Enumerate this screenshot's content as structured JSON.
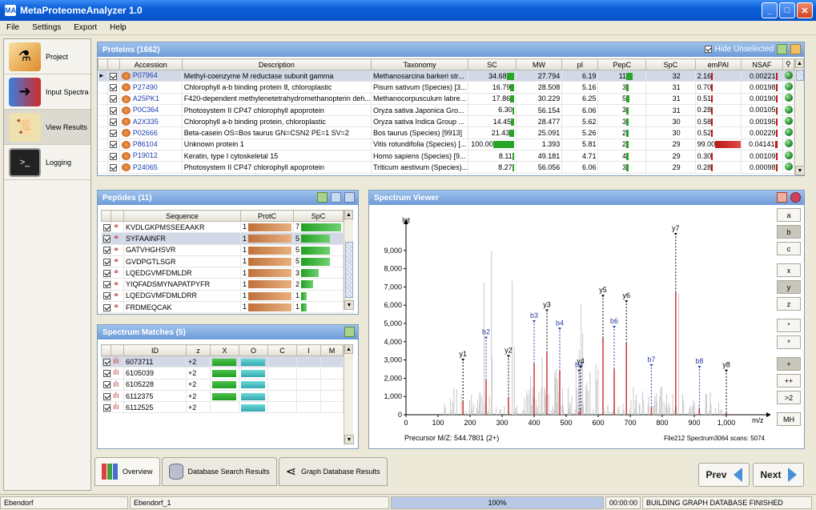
{
  "window": {
    "title": "MetaProteomeAnalyzer 1.0",
    "app_icon": "MA"
  },
  "menu": [
    "File",
    "Settings",
    "Export",
    "Help"
  ],
  "nav": [
    {
      "label": "Project",
      "icon": "flask-icon"
    },
    {
      "label": "Input Spectra",
      "icon": "spectra-arrow-icon"
    },
    {
      "label": "View Results",
      "icon": "scroll-icon"
    },
    {
      "label": "Logging",
      "icon": "terminal-icon"
    }
  ],
  "proteins": {
    "title": "Proteins (1662)",
    "hide_unselected": "Hide Unselected",
    "columns": [
      "Accession",
      "Description",
      "Taxonomy",
      "SC",
      "MW",
      "pI",
      "PepC",
      "SpC",
      "emPAI",
      "NSAF"
    ],
    "rows": [
      {
        "acc": "P07964",
        "desc": "Methyl-coenzyme M reductase subunit gamma",
        "tax": "Methanosarcina barkeri str...",
        "sc": "34.68",
        "sc_frac": 0.35,
        "mw": "27.794",
        "pi": "6.19",
        "pepc": "11",
        "pepc_frac": 1.0,
        "spc": "32",
        "empai": "2.16",
        "empai_frac": 0.02,
        "nsaf": "0.00221",
        "nsaf_frac": 0.05
      },
      {
        "acc": "P27490",
        "desc": "Chlorophyll a-b binding protein 8, chloroplastic",
        "tax": "Pisum sativum (Species) [3...",
        "sc": "16.79",
        "sc_frac": 0.17,
        "mw": "28.508",
        "pi": "5.16",
        "pepc": "3",
        "pepc_frac": 0.27,
        "spc": "31",
        "empai": "0.70",
        "empai_frac": 0.01,
        "nsaf": "0.00198",
        "nsaf_frac": 0.05
      },
      {
        "acc": "A25PK1",
        "desc": "F420-dependent methylenetetrahydromethanopterin deh...",
        "tax": "Methanocorpusculum labre...",
        "sc": "17.86",
        "sc_frac": 0.18,
        "mw": "30.229",
        "pi": "6.25",
        "pepc": "5",
        "pepc_frac": 0.45,
        "spc": "31",
        "empai": "0.51",
        "empai_frac": 0.01,
        "nsaf": "0.00190",
        "nsaf_frac": 0.05
      },
      {
        "acc": "P0C364",
        "desc": "Photosystem II CP47 chlorophyll apoprotein",
        "tax": "Oryza sativa Japonica Gro...",
        "sc": "6.30",
        "sc_frac": 0.06,
        "mw": "56.154",
        "pi": "6.06",
        "pepc": "3",
        "pepc_frac": 0.27,
        "spc": "31",
        "empai": "0.28",
        "empai_frac": 0.0,
        "nsaf": "0.00105",
        "nsaf_frac": 0.03
      },
      {
        "acc": "A2X335",
        "desc": "Chlorophyll a-b binding protein, chloroplastic",
        "tax": "Oryza sativa Indica Group ...",
        "sc": "14.45",
        "sc_frac": 0.14,
        "mw": "28.477",
        "pi": "5.62",
        "pepc": "3",
        "pepc_frac": 0.27,
        "spc": "30",
        "empai": "0.58",
        "empai_frac": 0.01,
        "nsaf": "0.00195",
        "nsaf_frac": 0.05
      },
      {
        "acc": "P02666",
        "desc": "Beta-casein OS=Bos taurus GN=CSN2 PE=1 SV=2",
        "tax": "Bos taurus (Species) [9913]",
        "sc": "21.43",
        "sc_frac": 0.21,
        "mw": "25.091",
        "pi": "5.26",
        "pepc": "2",
        "pepc_frac": 0.18,
        "spc": "30",
        "empai": "0.52",
        "empai_frac": 0.01,
        "nsaf": "0.00229",
        "nsaf_frac": 0.06
      },
      {
        "acc": "P86104",
        "desc": "Unknown protein 1",
        "tax": "Vitis rotundifolia (Species) [...",
        "sc": "100.00",
        "sc_frac": 1.0,
        "mw": "1.393",
        "pi": "5.81",
        "pepc": "2",
        "pepc_frac": 0.18,
        "spc": "29",
        "empai": "99.00",
        "empai_frac": 1.0,
        "nsaf": "0.04141",
        "nsaf_frac": 1.0
      },
      {
        "acc": "P19012",
        "desc": "Keratin, type I cytoskeletal 15",
        "tax": "Homo sapiens (Species) [9...",
        "sc": "8.11",
        "sc_frac": 0.08,
        "mw": "49.181",
        "pi": "4.71",
        "pepc": "4",
        "pepc_frac": 0.36,
        "spc": "29",
        "empai": "0.30",
        "empai_frac": 0.0,
        "nsaf": "0.00109",
        "nsaf_frac": 0.03
      },
      {
        "acc": "P24065",
        "desc": "Photosystem II CP47 chlorophyll apoprotein",
        "tax": "Triticum aestivum (Species)...",
        "sc": "8.27",
        "sc_frac": 0.08,
        "mw": "56.056",
        "pi": "6.06",
        "pepc": "3",
        "pepc_frac": 0.27,
        "spc": "29",
        "empai": "0.28",
        "empai_frac": 0.0,
        "nsaf": "0.00098",
        "nsaf_frac": 0.02
      }
    ]
  },
  "peptides": {
    "title": "Peptides (11)",
    "columns": [
      "Sequence",
      "ProtC",
      "SpC"
    ],
    "rows": [
      {
        "seq": "KVDLGKPMSSEEAAKR",
        "protc": "1",
        "spc": "7",
        "spc_frac": 1.0
      },
      {
        "seq": "SYFAAINFR",
        "protc": "1",
        "spc": "5",
        "spc_frac": 0.71
      },
      {
        "seq": "GATVHGHSVR",
        "protc": "1",
        "spc": "5",
        "spc_frac": 0.71
      },
      {
        "seq": "GVDPGTLSGR",
        "protc": "1",
        "spc": "5",
        "spc_frac": 0.71
      },
      {
        "seq": "LQEDGVMFDMLDR",
        "protc": "1",
        "spc": "3",
        "spc_frac": 0.43
      },
      {
        "seq": "YIQFADSMYNAPATPYFR",
        "protc": "1",
        "spc": "2",
        "spc_frac": 0.29
      },
      {
        "seq": "LQEDGVMFDMLDRR",
        "protc": "1",
        "spc": "1",
        "spc_frac": 0.14
      },
      {
        "seq": "FRDMEQCAK",
        "protc": "1",
        "spc": "1",
        "spc_frac": 0.14
      }
    ]
  },
  "matches": {
    "title": "Spectrum Matches (5)",
    "columns": [
      "ID",
      "z",
      "X",
      "O",
      "C",
      "I",
      "M"
    ],
    "rows": [
      {
        "id": "6073711",
        "z": "+2",
        "x": true,
        "o": true
      },
      {
        "id": "6105039",
        "z": "+2",
        "x": true,
        "o": true
      },
      {
        "id": "6105228",
        "z": "+2",
        "x": true,
        "o": true
      },
      {
        "id": "6112375",
        "z": "+2",
        "x": true,
        "o": true
      },
      {
        "id": "6112525",
        "z": "+2",
        "x": false,
        "o": true
      }
    ]
  },
  "spectrum": {
    "title": "Spectrum Viewer",
    "ylabel": "Int",
    "xlabel": "m/z",
    "precursor": "Precursor M/Z: 544.7801 (2+)",
    "file_info": "File212 Spectrum3064 scans: 5074",
    "buttons": [
      "a",
      "b",
      "c",
      "x",
      "y",
      "z",
      "°",
      "*",
      "+",
      "++",
      ">2",
      "MH"
    ],
    "active_buttons": [
      "b",
      "y",
      "+"
    ]
  },
  "chart_data": {
    "type": "bar",
    "xlabel": "m/z",
    "ylabel": "Int",
    "xlim": [
      0,
      1100
    ],
    "ylim": [
      0,
      10000
    ],
    "xticks": [
      0,
      100,
      200,
      300,
      400,
      500,
      600,
      700,
      800,
      900,
      1000
    ],
    "yticks": [
      0,
      1000,
      2000,
      3000,
      4000,
      5000,
      6000,
      7000,
      8000,
      9000
    ],
    "peaks": [
      {
        "label": "y1",
        "mz": 178,
        "int": 700,
        "series": "y"
      },
      {
        "label": "b2",
        "mz": 250,
        "int": 1900,
        "series": "b"
      },
      {
        "label": "y2",
        "mz": 320,
        "int": 900,
        "series": "y"
      },
      {
        "label": "b3",
        "mz": 400,
        "int": 2800,
        "series": "b"
      },
      {
        "label": "y3",
        "mz": 440,
        "int": 3400,
        "series": "y"
      },
      {
        "label": "b4",
        "mz": 480,
        "int": 2400,
        "series": "b"
      },
      {
        "label": "y4",
        "mz": 545,
        "int": 300,
        "series": "y"
      },
      {
        "label": "b4",
        "mz": 540,
        "int": 100,
        "series": "b"
      },
      {
        "label": "y5",
        "mz": 615,
        "int": 4200,
        "series": "y"
      },
      {
        "label": "b6",
        "mz": 650,
        "int": 2500,
        "series": "b"
      },
      {
        "label": "y6",
        "mz": 688,
        "int": 3900,
        "series": "y"
      },
      {
        "label": "b7",
        "mz": 766,
        "int": 400,
        "series": "b"
      },
      {
        "label": "y7",
        "mz": 842,
        "int": 6700,
        "series": "y"
      },
      {
        "label": "b8",
        "mz": 916,
        "int": 300,
        "series": "b"
      },
      {
        "label": "y8",
        "mz": 1000,
        "int": 100,
        "series": "y"
      }
    ]
  },
  "tabs": [
    "Overview",
    "Database Search Results",
    "Graph Database Results"
  ],
  "prev_label": "Prev",
  "next_label": "Next",
  "status": {
    "user": "Ebendorf",
    "project": "Ebendorf_1",
    "progress": "100%",
    "progress_value": 1.0,
    "time": "00:00:00",
    "message": "BUILDING GRAPH DATABASE FINISHED"
  },
  "colors": {
    "accent": "#0a5fd8",
    "bar_green": "#28a428",
    "bar_red": "#c01818",
    "peak_red": "#c62828",
    "label_blue": "#2a3aa8"
  }
}
